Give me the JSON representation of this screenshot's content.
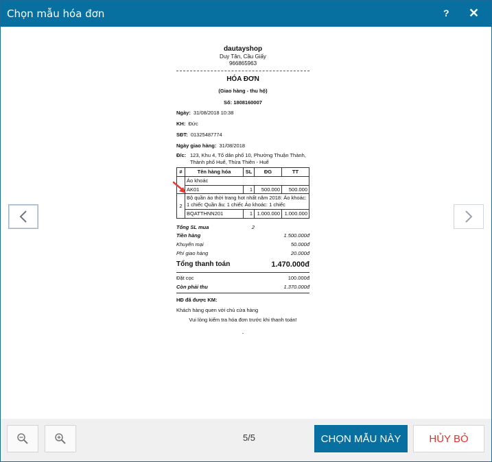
{
  "dialog": {
    "title": "Chọn mẫu hóa đơn",
    "help_label": "?",
    "close_label": "✕"
  },
  "receipt": {
    "shop_name": "dautayshop",
    "shop_address": "Duy Tân, Cầu Giấy",
    "shop_phone": "966865963",
    "title": "HÓA ĐƠN",
    "subtitle": "(Giao hàng - thu hộ)",
    "number_label": "Số:",
    "number": "1808160007",
    "date_label": "Ngày:",
    "date": "31/08/2018 10:38",
    "customer_label": "KH:",
    "customer": "Đức",
    "phone_label": "SĐT:",
    "phone": "01325487774",
    "delivery_date_label": "Ngày giao hàng:",
    "delivery_date": "31/08/2018",
    "address_label": "Đ/c:",
    "address": "123, Khu 4, Tổ dân phố 10, Phường Thuận Thành, Thành phố Huế, Thừa Thiên - Huế",
    "table": {
      "headers": [
        "#",
        "Tên hàng hóa",
        "SL",
        "ĐG",
        "TT"
      ],
      "items": [
        {
          "index": "",
          "desc": "Áo khoác",
          "code": "AK01",
          "qty": "1",
          "price": "500.000",
          "total": "500.000"
        },
        {
          "index": "2",
          "desc": "Bộ quần áo thời trang hot nhất năm 2018: Áo khoác: 1 chiếc Quần âu: 1 chiếc Áo khoác: 1 chiếc",
          "code": "BQATTHNN201",
          "qty": "1",
          "price": "1.000.000",
          "total": "1.000.000"
        }
      ]
    },
    "summary": {
      "total_qty_label": "Tổng SL mua",
      "total_qty": "2",
      "goods_label": "Tiền hàng",
      "goods": "1.500.000đ",
      "discount_label": "Khuyến mại",
      "discount": "50.000đ",
      "shipping_label": "Phí giao hàng",
      "shipping": "20.000đ",
      "grand_total_label": "Tổng thanh toán",
      "grand_total": "1.470.000đ",
      "deposit_label": "Đặt cọc",
      "deposit": "100.000đ",
      "remaining_label": "Còn phải thu",
      "remaining": "1.370.000đ"
    },
    "promo_label": "HĐ đã được KM:",
    "promo_note": "Khách hàng quen với chủ cửa hàng",
    "footer_note": "Vui lòng kiểm tra hóa đơn trước khi thanh toán!",
    "end_mark": "."
  },
  "icons": {
    "prev": "chevron-left-icon",
    "next": "chevron-right-icon",
    "zoom_out": "zoom-out-icon",
    "zoom_in": "zoom-in-icon"
  },
  "footer": {
    "page_indicator": "5/5",
    "choose_label": "CHỌN MẪU NÀY",
    "cancel_label": "HỦY BỎ"
  },
  "colors": {
    "primary": "#086fa1",
    "cancel_text": "#e0332c",
    "arrow": "#e53935"
  }
}
